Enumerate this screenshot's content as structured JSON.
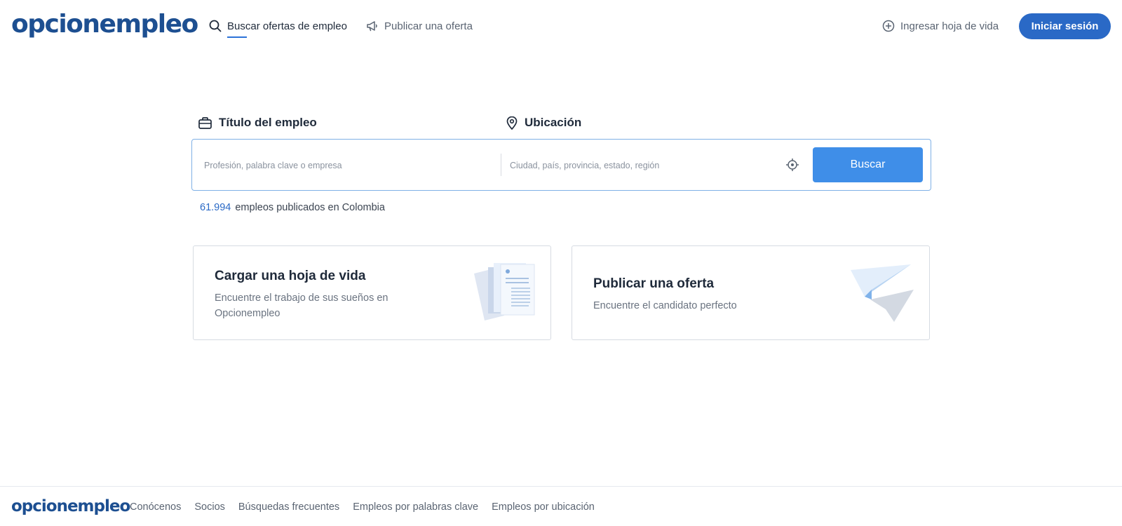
{
  "header": {
    "logo": "opcionempleo",
    "nav": {
      "search_jobs": "Buscar ofertas de empleo",
      "publish_offer": "Publicar una oferta",
      "upload_cv": "Ingresar hoja de vida"
    },
    "login_label": "Iniciar sesión"
  },
  "search": {
    "job_label": "Título del empleo",
    "location_label": "Ubicación",
    "job_placeholder": "Profesión, palabra clave o empresa",
    "location_placeholder": "Ciudad, país, provincia, estado, región",
    "button_label": "Buscar",
    "job_count": "61.994",
    "job_count_text": "empleos publicados en Colombia"
  },
  "cards": {
    "cv": {
      "title": "Cargar una hoja de vida",
      "description": "Encuentre el trabajo de sus sueños en Opcionempleo"
    },
    "offer": {
      "title": "Publicar una oferta",
      "description": "Encuentre el candidato perfecto"
    }
  },
  "footer": {
    "logo": "opcionempleo",
    "links": [
      "Conócenos",
      "Socios",
      "Búsquedas frecuentes",
      "Empleos por palabras clave",
      "Empleos por ubicación"
    ]
  },
  "icons": {
    "search_nav": "search-icon",
    "publish_nav": "megaphone-icon",
    "cv_nav": "plus-circle-icon",
    "job_label": "briefcase-icon",
    "location_label": "location-pin-icon",
    "locate": "crosshair-icon"
  },
  "colors": {
    "brand": "#1d4f91",
    "login_button": "#2a69c6",
    "search_button": "#3f8ee8",
    "count_number": "#2a69c6"
  }
}
